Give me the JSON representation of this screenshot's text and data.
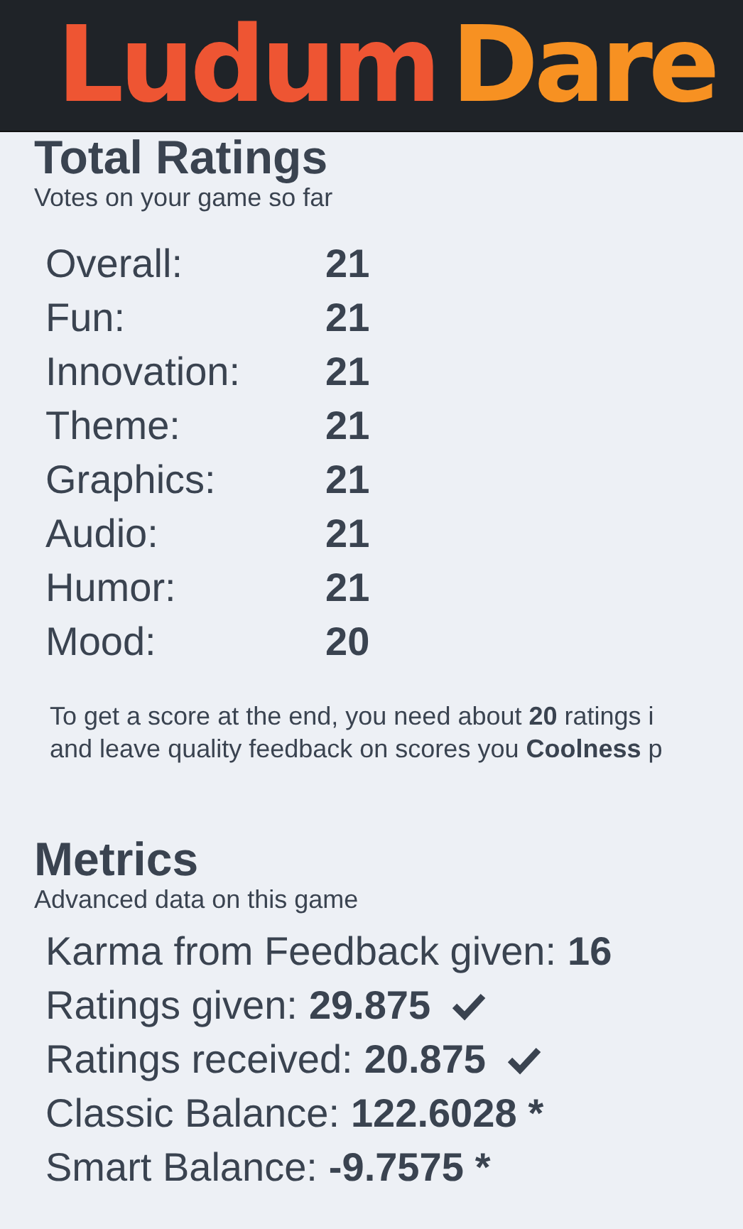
{
  "header": {
    "logo": [
      {
        "text": "Ludum",
        "color": "#ee5533"
      },
      {
        "text": "Dare",
        "color": "#f79122"
      }
    ]
  },
  "total_ratings": {
    "title": "Total Ratings",
    "subtitle": "Votes on your game so far",
    "rows": [
      {
        "label": "Overall:",
        "value": "21"
      },
      {
        "label": "Fun:",
        "value": "21"
      },
      {
        "label": "Innovation:",
        "value": "21"
      },
      {
        "label": "Theme:",
        "value": "21"
      },
      {
        "label": "Graphics:",
        "value": "21"
      },
      {
        "label": "Audio:",
        "value": "21"
      },
      {
        "label": "Humor:",
        "value": "21"
      },
      {
        "label": "Mood:",
        "value": "20"
      }
    ],
    "note": [
      "To get a score at the end, you need about **20** ratings i",
      "and leave quality feedback on scores you **Coolness** p"
    ]
  },
  "metrics": {
    "title": "Metrics",
    "subtitle": "Advanced data on this game",
    "rows": [
      {
        "label": "Karma from Feedback given:",
        "value": "16",
        "verified": false
      },
      {
        "label": "Ratings given:",
        "value": "29.875",
        "verified": true
      },
      {
        "label": "Ratings received:",
        "value": "20.875",
        "verified": true
      },
      {
        "label": "Classic Balance:",
        "value": "122.6028",
        "suffix": "*",
        "verified": false
      },
      {
        "label": "Smart Balance:",
        "value": "-9.7575",
        "suffix": "*",
        "verified": false
      }
    ]
  }
}
